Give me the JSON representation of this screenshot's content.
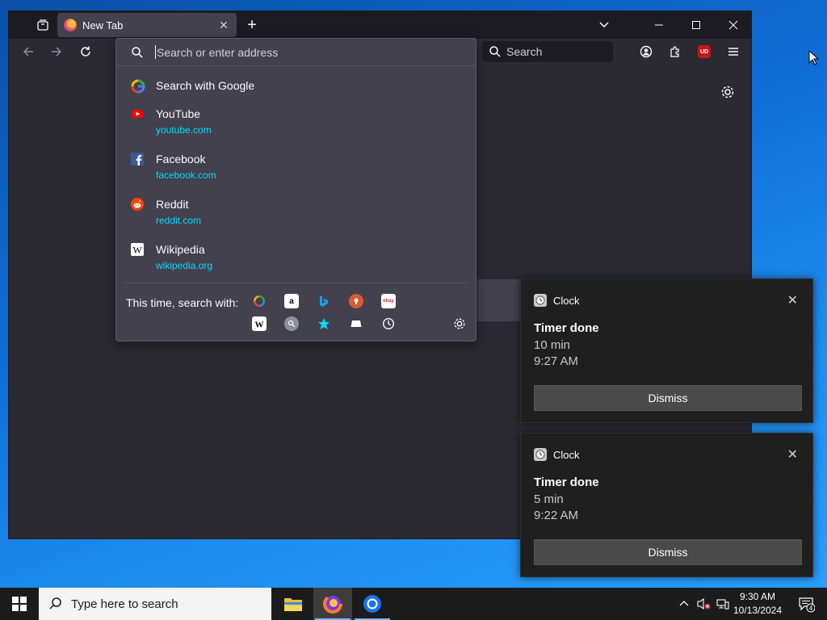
{
  "browser": {
    "tab_title": "New Tab",
    "search_placeholder": "Search",
    "ubo_label": "UD"
  },
  "dropdown": {
    "placeholder": "Search or enter address",
    "results": [
      {
        "title": "Search with Google",
        "url": "",
        "icon": "google-icon"
      },
      {
        "title": "YouTube",
        "url": "youtube.com",
        "icon": "youtube-icon"
      },
      {
        "title": "Facebook",
        "url": "facebook.com",
        "icon": "facebook-icon"
      },
      {
        "title": "Reddit",
        "url": "reddit.com",
        "icon": "reddit-icon"
      },
      {
        "title": "Wikipedia",
        "url": "wikipedia.org",
        "icon": "wikipedia-icon"
      }
    ],
    "this_time_label": "This time, search with:",
    "engine_labels": {
      "amazon": "a",
      "wikipedia": "W",
      "ebay": "ebay"
    }
  },
  "notifications": [
    {
      "app": "Clock",
      "heading": "Timer done",
      "line1": "10 min",
      "line2": "9:27 AM",
      "button": "Dismiss"
    },
    {
      "app": "Clock",
      "heading": "Timer done",
      "line1": "5 min",
      "line2": "9:22 AM",
      "button": "Dismiss"
    }
  ],
  "taskbar": {
    "search_placeholder": "Type here to search",
    "time": "9:30 AM",
    "date": "10/13/2024",
    "notification_count": "4"
  }
}
